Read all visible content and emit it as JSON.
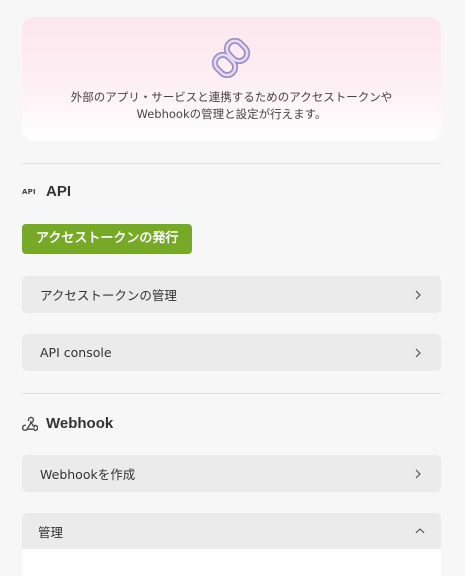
{
  "hero": {
    "icon": "link-icon",
    "description_line1": "外部のアプリ・サービスと連携するためのアクセストークンや",
    "description_line2": "Webhookの管理と設定が行えます。"
  },
  "api_section": {
    "icon": "api-icon",
    "icon_text": "API",
    "title": "API",
    "issue_button": "アクセストークンの発行",
    "rows": [
      {
        "label": "アクセストークンの管理",
        "icon": "chevron-right-icon"
      },
      {
        "label": "API console",
        "icon": "chevron-right-icon"
      }
    ]
  },
  "webhook_section": {
    "icon": "webhook-icon",
    "title": "Webhook",
    "create_row": {
      "label": "Webhookを作成",
      "icon": "chevron-right-icon"
    },
    "manage_accordion": {
      "label": "管理",
      "icon": "chevron-up-icon",
      "expanded": true
    }
  },
  "colors": {
    "primary_button": "#76a925",
    "row_background": "#ebebeb",
    "page_background": "#f7f7f7",
    "hero_gradient_top": "#fde6ee"
  }
}
